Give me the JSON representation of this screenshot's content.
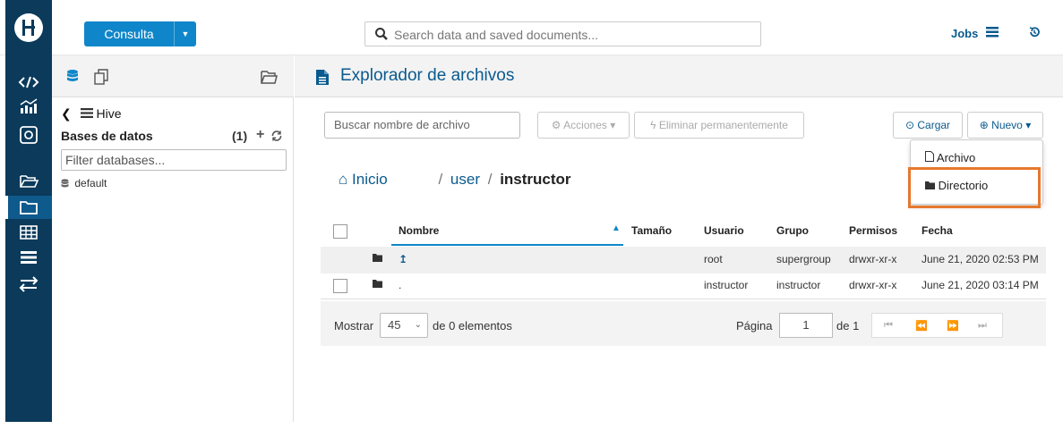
{
  "topbar": {
    "query_button": "Consulta",
    "search_placeholder": "Search data and saved documents...",
    "jobs": "Jobs"
  },
  "assist": {
    "source": "Hive",
    "databases_title": "Bases de datos",
    "databases_count": "(1)",
    "filter_placeholder": "Filter databases...",
    "databases": [
      "default"
    ]
  },
  "main": {
    "title": "Explorador de archivos",
    "file_search_placeholder": "Buscar nombre de archivo",
    "actions": {
      "acciones": "Acciones",
      "eliminar": "Eliminar permanentemente",
      "cargar": "Cargar",
      "nuevo": "Nuevo"
    },
    "breadcrumb": {
      "home": "Inicio",
      "sep1": "/",
      "user": "user",
      "sep2": "/",
      "current": "instructor"
    },
    "table": {
      "headers": [
        "Nombre",
        "Tamaño",
        "Usuario",
        "Grupo",
        "Permisos",
        "Fecha"
      ],
      "rows": [
        {
          "name": "↥",
          "size": "",
          "user": "root",
          "group": "supergroup",
          "perms": "drwxr-xr-x",
          "date": "June 21, 2020 02:53 PM"
        },
        {
          "name": ".",
          "size": "",
          "user": "instructor",
          "group": "instructor",
          "perms": "drwxr-xr-x",
          "date": "June 21, 2020 03:14 PM"
        }
      ]
    },
    "pager": {
      "mostrar": "Mostrar",
      "page_size": "45",
      "of_elements": "de 0 elementos",
      "pagina": "Página",
      "page": "1",
      "of_pages": "de 1"
    },
    "new_menu": {
      "archivo": "Archivo",
      "directorio": "Directorio"
    }
  },
  "colors": {
    "nav_bg": "#0b3a5b",
    "accent": "#0f86c9",
    "link": "#0a5a8e",
    "highlight": "#e6782e"
  }
}
